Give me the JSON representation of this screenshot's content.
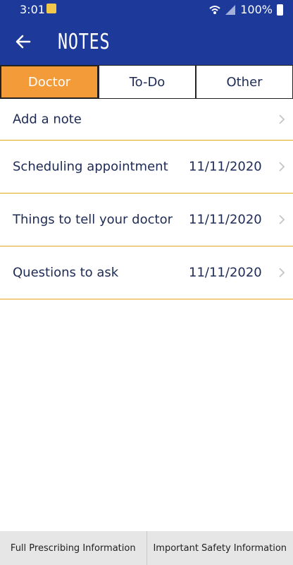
{
  "status_bar": {
    "time": "3:01",
    "battery": "100%"
  },
  "header": {
    "title": "NOTES"
  },
  "tabs": [
    {
      "label": "Doctor",
      "active": true
    },
    {
      "label": "To-Do",
      "active": false
    },
    {
      "label": "Other",
      "active": false
    }
  ],
  "notes": {
    "add_label": "Add a note",
    "items": [
      {
        "title": "Scheduling appointment",
        "date": "11/11/2020"
      },
      {
        "title": "Things to tell your doctor",
        "date": "11/11/2020"
      },
      {
        "title": "Questions to ask",
        "date": "11/11/2020"
      }
    ]
  },
  "footer": {
    "prescribing_label": "Full Prescribing Information",
    "safety_label": "Important Safety Information"
  },
  "colors": {
    "header_blue": "#1d3a9a",
    "tab_active": "#f29b38",
    "divider": "#e6a520",
    "text": "#1d2a55"
  }
}
